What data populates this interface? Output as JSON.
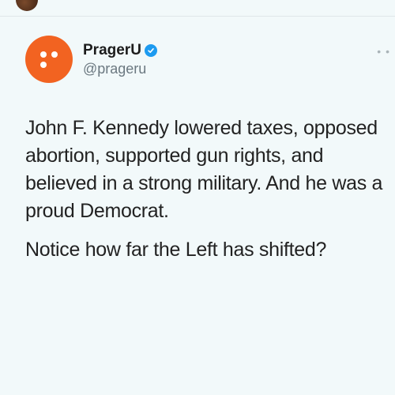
{
  "account": {
    "display_name": "PragerU",
    "handle": "@prageru",
    "verified": true,
    "avatar_color": "#f26321",
    "verified_color": "#1d9bf0"
  },
  "tweet": {
    "paragraph_1": "John F. Kennedy lowered taxes, opposed abortion, supported gun rights, and believed in a strong military. And he was a proud Democrat.",
    "paragraph_2": "Notice how far the Left has shifted?"
  },
  "icons": {
    "verified": "verified-badge-icon",
    "more": "more-options-icon"
  }
}
